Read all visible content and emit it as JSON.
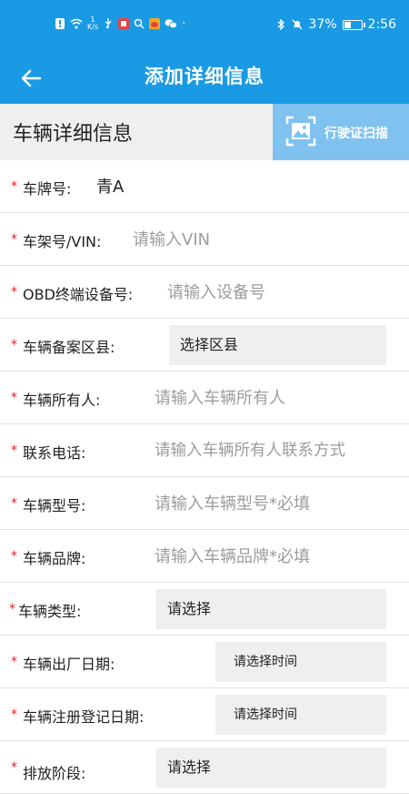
{
  "status_bar": {
    "net_speed_top": "1",
    "net_speed_unit": "K/s",
    "battery": "37%",
    "time": "2:56"
  },
  "app_bar": {
    "title": "添加详细信息",
    "back_icon": "arrow-left-icon"
  },
  "section": {
    "title": "车辆详细信息",
    "scan_label": "行驶证扫描",
    "scan_icon": "image-scan-icon"
  },
  "form": {
    "plate": {
      "label": "车牌号:",
      "value": "青A"
    },
    "vin": {
      "label": "车架号/VIN:",
      "placeholder": "请输入VIN"
    },
    "obd": {
      "label": "OBD终端设备号:",
      "placeholder": "请输入设备号"
    },
    "district": {
      "label": "车辆备案区县:",
      "value": "选择区县"
    },
    "owner": {
      "label": "车辆所有人:",
      "placeholder": "请输入车辆所有人"
    },
    "phone": {
      "label": "联系电话:",
      "placeholder": "请输入车辆所有人联系方式"
    },
    "model": {
      "label": "车辆型号:",
      "placeholder": "请输入车辆型号*必填"
    },
    "brand": {
      "label": "车辆品牌:",
      "placeholder": "请输入车辆品牌*必填"
    },
    "type": {
      "label": "车辆类型:",
      "value": "请选择"
    },
    "factory_date": {
      "label": "车辆出厂日期:",
      "value": "请选择时间"
    },
    "register_date": {
      "label": "车辆注册登记日期:",
      "value": "请选择时间"
    },
    "emission": {
      "label": "排放阶段:",
      "value": "请选择"
    }
  },
  "required_mark": "*",
  "colors": {
    "primary": "#1a9ae4",
    "scan_button": "#7fc2ef",
    "required": "#e02020",
    "placeholder": "#9c9c9c",
    "select_bg": "#f1eeee"
  }
}
